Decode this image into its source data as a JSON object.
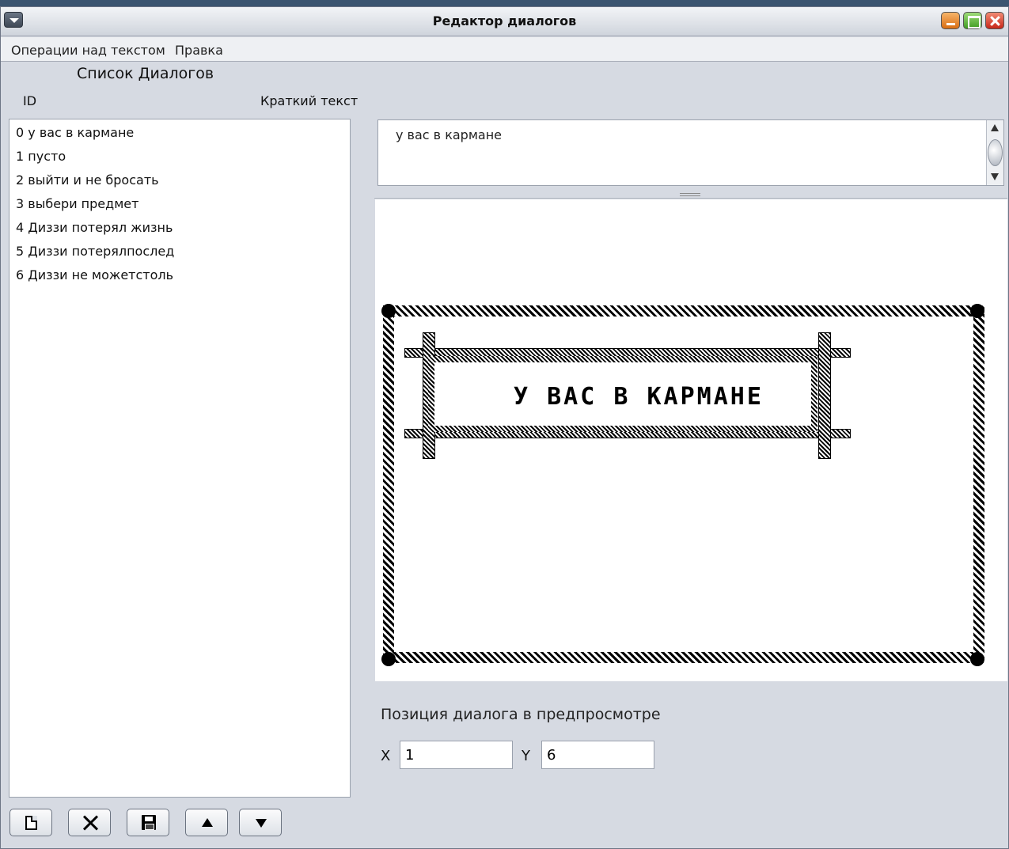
{
  "window": {
    "title": "Редактор диалогов"
  },
  "menu": {
    "items": [
      "Операции над текстом",
      "Правка"
    ]
  },
  "list": {
    "title": "Список Диалогов",
    "col_id": "ID",
    "col_text": "Краткий текст",
    "rows": [
      "0 у вас в кармане",
      "1 пусто",
      "2 выйти и не бросать",
      "3 выбери предмет",
      "4 Диззи потерял жизнь",
      "5 Диззи потерялпослед",
      "6 Диззи не можетстоль"
    ]
  },
  "toolbar": {
    "buttons": [
      {
        "icon": "new-document-icon"
      },
      {
        "icon": "delete-icon"
      },
      {
        "icon": "save-icon"
      },
      {
        "icon": "arrow-up-icon"
      },
      {
        "icon": "arrow-down-icon"
      }
    ]
  },
  "editor": {
    "text": "у вас в кармане"
  },
  "preview": {
    "text": "У ВАС В КАРМАНЕ"
  },
  "position": {
    "title": "Позиция диалога в предпросмотре",
    "x_label": "X",
    "x_value": "1",
    "y_label": "Y",
    "y_value": "6"
  },
  "colors": {
    "background": "#d6dae2",
    "minimize": "#e07a1f",
    "maximize": "#4aa82a",
    "close": "#d0301f"
  }
}
